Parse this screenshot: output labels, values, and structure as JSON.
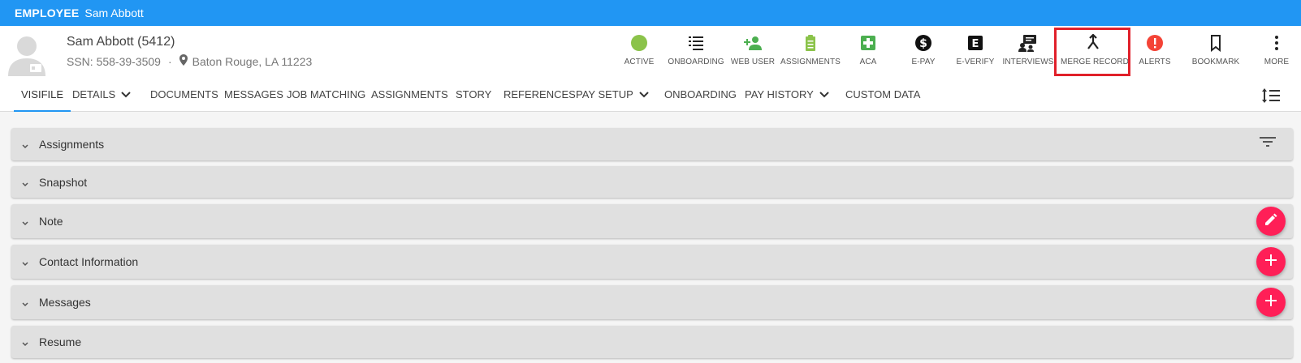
{
  "topbar": {
    "kind": "EMPLOYEE",
    "name": "Sam Abbott"
  },
  "employee": {
    "title": "Sam Abbott (5412)",
    "ssn": "SSN: 558-39-3509",
    "separator": "·",
    "location": "Baton Rouge, LA 11223"
  },
  "actions": [
    {
      "label": "ACTIVE",
      "icon": "status-dot-icon",
      "color": "#8bc34a"
    },
    {
      "label": "ONBOARDING",
      "icon": "checklist-icon",
      "color": "#222222"
    },
    {
      "label": "WEB USER",
      "icon": "add-person-icon",
      "color": "#4caf50"
    },
    {
      "label": "ASSIGNMENTS",
      "icon": "clipboard-icon",
      "color": "#8bc34a"
    },
    {
      "label": "ACA",
      "icon": "medical-plus-icon",
      "color": "#4caf50"
    },
    {
      "label": "E-PAY",
      "icon": "dollar-icon",
      "color": "#111111"
    },
    {
      "label": "E-VERIFY",
      "icon": "e-badge-icon",
      "color": "#111111"
    },
    {
      "label": "INTERVIEWS",
      "icon": "presenter-icon",
      "color": "#222222"
    },
    {
      "label": "MERGE RECORD",
      "icon": "merge-icon",
      "color": "#222222"
    },
    {
      "label": "ALERTS",
      "icon": "alert-icon",
      "color": "#f44336"
    },
    {
      "label": "BOOKMARK",
      "icon": "bookmark-icon",
      "color": "#222222"
    },
    {
      "label": "MORE",
      "icon": "more-vert-icon",
      "color": "#222222"
    }
  ],
  "tabs": [
    {
      "label": "VISIFILE",
      "active": true
    },
    {
      "label": "DETAILS",
      "dropdown": true
    },
    {
      "label": "DOCUMENTS"
    },
    {
      "label": "MESSAGES"
    },
    {
      "label": "JOB MATCHING"
    },
    {
      "label": "ASSIGNMENTS"
    },
    {
      "label": "STORY"
    },
    {
      "label": "REFERENCES"
    },
    {
      "label": "PAY SETUP",
      "dropdown": true
    },
    {
      "label": "ONBOARDING"
    },
    {
      "label": "PAY HISTORY",
      "dropdown": true
    },
    {
      "label": "CUSTOM DATA"
    }
  ],
  "panels": [
    {
      "title": "Assignments",
      "tool": "filter"
    },
    {
      "title": "Snapshot"
    },
    {
      "title": "Note",
      "tool": "edit"
    },
    {
      "title": "Contact Information",
      "tool": "add"
    },
    {
      "title": "Messages",
      "tool": "add"
    },
    {
      "title": "Resume"
    }
  ],
  "colors": {
    "brand": "#2196f3",
    "fab": "#ff1f57",
    "highlight": "#e0202a"
  }
}
